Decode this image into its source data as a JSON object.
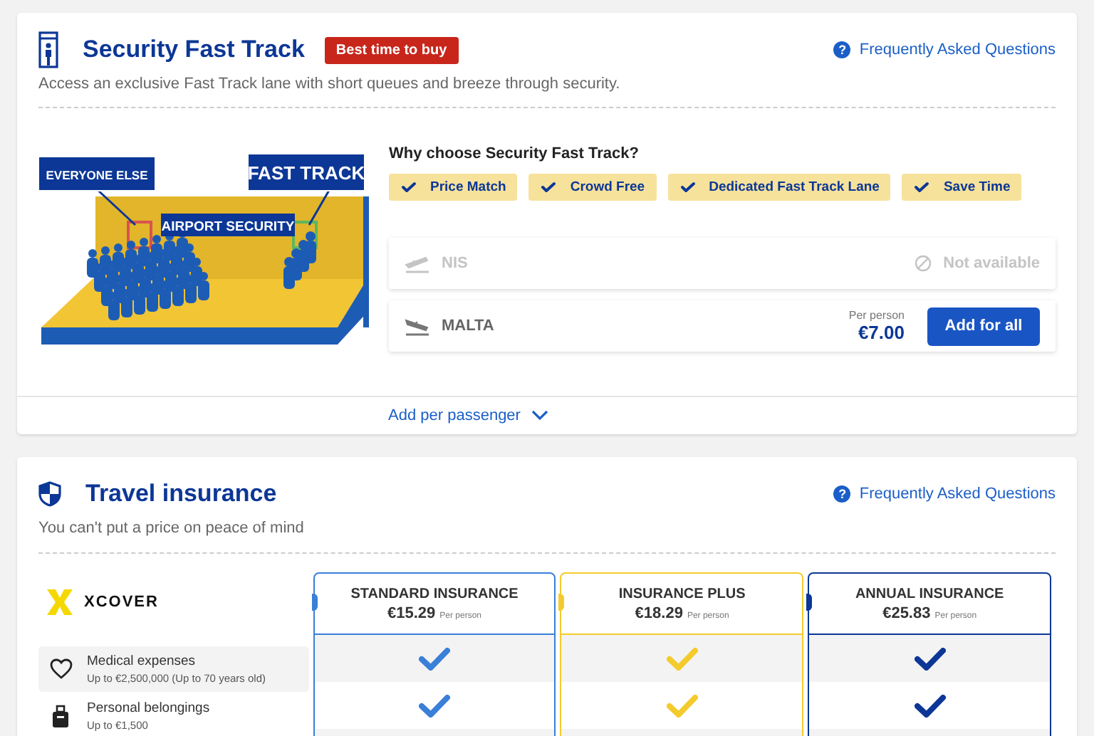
{
  "fast_track": {
    "title": "Security Fast Track",
    "badge": "Best time to buy",
    "faq_icon": "?",
    "faq_link": "Frequently Asked Questions",
    "description": "Access an exclusive Fast Track lane with short queues and breeze through security.",
    "illustration": {
      "left_label": "EVERYONE ELSE",
      "right_label": "FAST TRACK",
      "center_label": "AIRPORT SECURITY"
    },
    "benefits_title": "Why choose Security Fast Track?",
    "benefits": [
      "Price Match",
      "Crowd Free",
      "Dedicated Fast Track Lane",
      "Save Time"
    ],
    "flights": [
      {
        "name": "NIS",
        "kind": "departure",
        "available": false,
        "status": "Not available"
      },
      {
        "name": "MALTA",
        "kind": "arrival",
        "available": true,
        "price_label": "Per person",
        "price": "€7.00",
        "button": "Add for all"
      }
    ],
    "toggle": "Add per passenger"
  },
  "insurance": {
    "title": "Travel insurance",
    "faq_icon": "?",
    "faq_link": "Frequently Asked Questions",
    "subtitle": "You can't put a price on peace of mind",
    "provider": "XCOVER",
    "plans": [
      {
        "name": "STANDARD INSURANCE",
        "price": "€15.29",
        "per_person": "Per person",
        "color": "#3a7fd8"
      },
      {
        "name": "INSURANCE PLUS",
        "price": "€18.29",
        "per_person": "Per person",
        "color": "#f4cb2c"
      },
      {
        "name": "ANNUAL INSURANCE",
        "price": "€25.83",
        "per_person": "Per person",
        "color": "#0c3796"
      }
    ],
    "features": [
      {
        "kind": "medical",
        "name": "Medical expenses",
        "detail": "Up to €2,500,000 (Up to 70 years old)",
        "included": [
          true,
          true,
          true
        ]
      },
      {
        "kind": "belongings",
        "name": "Personal belongings",
        "detail": "Up to €1,500",
        "included": [
          true,
          true,
          true
        ]
      }
    ]
  }
}
